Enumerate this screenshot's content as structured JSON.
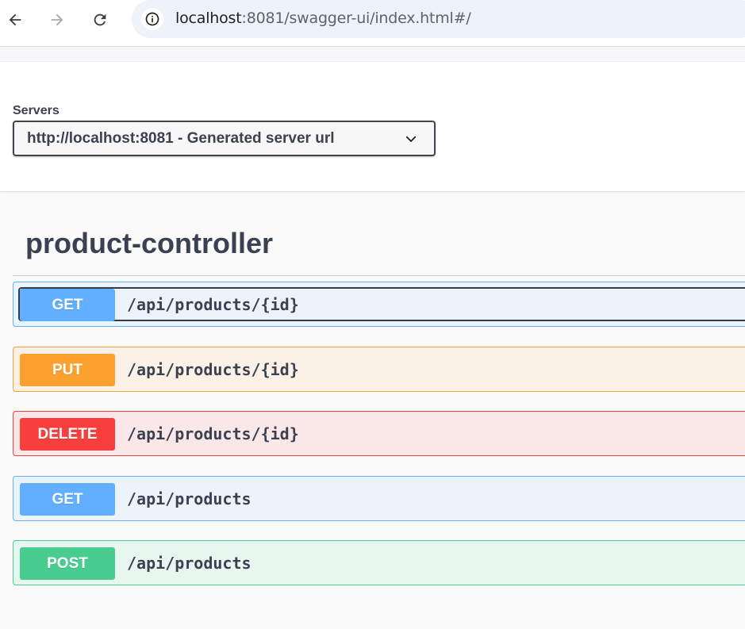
{
  "browser": {
    "url_host": "localhost",
    "url_rest": ":8081/swagger-ui/index.html#/"
  },
  "servers": {
    "label": "Servers",
    "selected": "http://localhost:8081 - Generated server url"
  },
  "controller": {
    "title": "product-controller",
    "operations": [
      {
        "method": "GET",
        "path": "/api/products/{id}",
        "color": "#61affe"
      },
      {
        "method": "PUT",
        "path": "/api/products/{id}",
        "color": "#fca130"
      },
      {
        "method": "DELETE",
        "path": "/api/products/{id}",
        "color": "#f93e3e"
      },
      {
        "method": "GET",
        "path": "/api/products",
        "color": "#61affe"
      },
      {
        "method": "POST",
        "path": "/api/products",
        "color": "#49cc90"
      }
    ]
  },
  "icons": {
    "back": "arrow-left-icon",
    "forward": "arrow-right-icon",
    "reload": "reload-icon",
    "site_info": "info-icon",
    "dropdown": "chevron-down-icon"
  }
}
